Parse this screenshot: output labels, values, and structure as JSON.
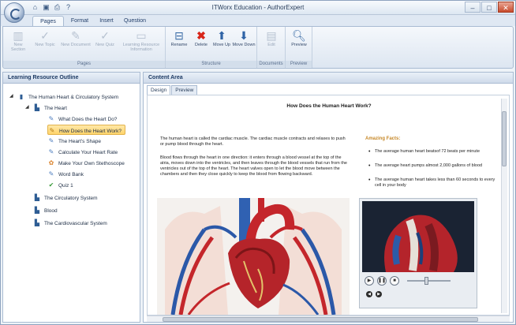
{
  "window": {
    "title": "ITWorx Education - AuthorExpert",
    "qat_icons": [
      "home-icon",
      "save-icon",
      "print-icon",
      "help-icon"
    ],
    "controls": {
      "minimize": "–",
      "maximize": "□",
      "close": "✕"
    }
  },
  "ribbon_tabs": [
    "Pages",
    "Format",
    "Insert",
    "Question"
  ],
  "ribbon": {
    "groups": [
      {
        "label": "Pages",
        "buttons": [
          {
            "label": "New Section",
            "icon": "chart-icon",
            "enabled": false
          },
          {
            "label": "New Topic",
            "icon": "check-icon",
            "enabled": false
          },
          {
            "label": "New Document",
            "icon": "document-icon",
            "enabled": false
          },
          {
            "label": "New Quiz",
            "icon": "check-icon",
            "enabled": false
          },
          {
            "label": "Learning Resource Information",
            "icon": "info-icon",
            "enabled": false
          }
        ]
      },
      {
        "label": "Structure",
        "buttons": [
          {
            "label": "Rename",
            "icon": "rename-icon",
            "enabled": true
          },
          {
            "label": "Delete",
            "icon": "delete-icon",
            "enabled": true
          },
          {
            "label": "Move Up",
            "icon": "arrow-up-icon",
            "enabled": true
          },
          {
            "label": "Move Down",
            "icon": "arrow-down-icon",
            "enabled": true
          }
        ]
      },
      {
        "label": "Documents",
        "buttons": [
          {
            "label": "Edit",
            "icon": "edit-icon",
            "enabled": false
          }
        ]
      },
      {
        "label": "Preview",
        "buttons": [
          {
            "label": "Preview",
            "icon": "preview-icon",
            "enabled": true
          }
        ]
      }
    ]
  },
  "outline": {
    "header": "Learning Resource Outline",
    "items": [
      {
        "label": "The Human Heart & Circulatory System",
        "icon": "book-icon",
        "level": 0,
        "expanded": true
      },
      {
        "label": "The Heart",
        "icon": "section-icon",
        "level": 1,
        "expanded": true
      },
      {
        "label": "What Does the Heart Do?",
        "icon": "page-icon",
        "level": 2
      },
      {
        "label": "How Does the Heart Work?",
        "icon": "edit-page-icon",
        "level": 2,
        "selected": true
      },
      {
        "label": "The Heart's Shape",
        "icon": "page-icon",
        "level": 2
      },
      {
        "label": "Calculate Your Heart Rate",
        "icon": "page-icon",
        "level": 2
      },
      {
        "label": "Make Your Own Stethoscope",
        "icon": "activity-icon",
        "level": 2
      },
      {
        "label": "Word Bank",
        "icon": "page-icon",
        "level": 2
      },
      {
        "label": "Quiz 1",
        "icon": "quiz-icon",
        "level": 2
      },
      {
        "label": "The Circulatory System",
        "icon": "section-icon",
        "level": 1
      },
      {
        "label": "Blood",
        "icon": "section-icon",
        "level": 1
      },
      {
        "label": "The Cardiovascular System",
        "icon": "section-icon",
        "level": 1
      }
    ]
  },
  "content": {
    "header": "Content Area",
    "tabs": [
      "Design",
      "Preview"
    ],
    "page_title": "How Does the Human Heart Work?",
    "para1": "The human heart is called the cardiac muscle. The cardiac muscle contracts and relaxes to push or pump blood through the heart.",
    "para2": "Blood flows through the heart in one direction: it enters through a blood vessel at the top of the atria, moves down into the ventricles, and then leaves through the blood vessels that run from the ventricles out of the top of the heart. The heart valves open to let the blood move between the chambers and then they close quickly to keep the blood from flowing backward.",
    "facts_title": "Amazing Facts:",
    "facts": [
      "The average human heart beatsof 72 beats per minute",
      "The average heart pumps almost 2,000 gallons of blood",
      "The average human heart takes less than 60 seconds to every cell in your body"
    ]
  }
}
